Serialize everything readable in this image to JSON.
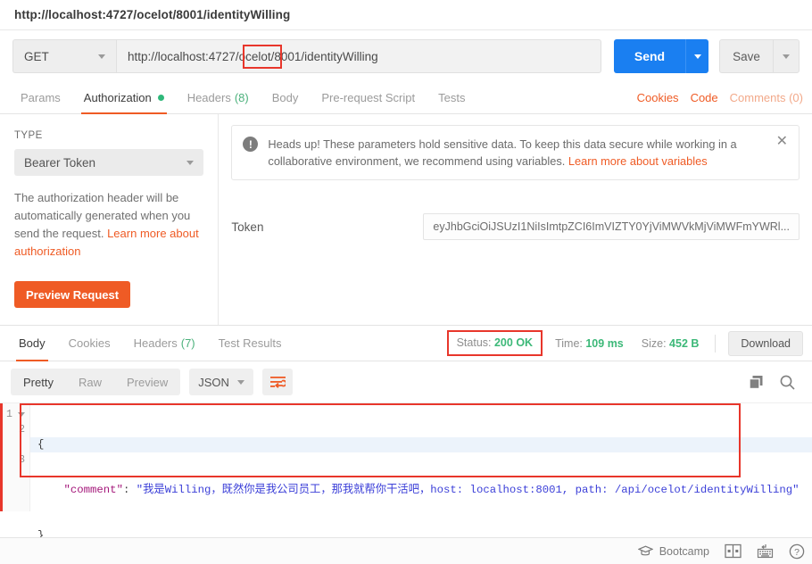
{
  "titlebar": {
    "url": "http://localhost:4727/ocelot/8001/identityWilling"
  },
  "request": {
    "method": "GET",
    "url": "http://localhost:4727/ocelot/8001/identityWilling",
    "url_highlight_fragment": "/8001",
    "send_label": "Send",
    "save_label": "Save",
    "tabs": [
      {
        "label": "Params",
        "count": "",
        "dot": false,
        "active": false
      },
      {
        "label": "Authorization",
        "count": "",
        "dot": true,
        "active": true
      },
      {
        "label": "Headers",
        "count": "(8)",
        "dot": false,
        "active": false
      },
      {
        "label": "Body",
        "count": "",
        "dot": false,
        "active": false
      },
      {
        "label": "Pre-request Script",
        "count": "",
        "dot": false,
        "active": false
      },
      {
        "label": "Tests",
        "count": "",
        "dot": false,
        "active": false
      }
    ],
    "right_links": [
      {
        "label": "Cookies",
        "muted": false
      },
      {
        "label": "Code",
        "muted": false
      },
      {
        "label": "Comments (0)",
        "muted": true
      }
    ]
  },
  "auth": {
    "type_label": "TYPE",
    "type_value": "Bearer Token",
    "description_text": "The authorization header will be automatically generated when you send the request. ",
    "description_link": "Learn more about authorization",
    "preview_button": "Preview Request",
    "notice_icon": "!",
    "notice_text": "Heads up! These parameters hold sensitive data. To keep this data secure while working in a collaborative environment, we recommend using variables. ",
    "notice_link": "Learn more about variables",
    "notice_close": "✕",
    "token_label": "Token",
    "token_value": "eyJhbGciOiJSUzI1NiIsImtpZCI6ImVIZTY0YjViMWVkMjViMWFmYWRl..."
  },
  "response": {
    "tabs": [
      {
        "label": "Body",
        "count": "",
        "active": true
      },
      {
        "label": "Cookies",
        "count": "",
        "active": false
      },
      {
        "label": "Headers",
        "count": "(7)",
        "active": false
      },
      {
        "label": "Test Results",
        "count": "",
        "active": false
      }
    ],
    "status_label": "Status:",
    "status_value": "200 OK",
    "time_label": "Time:",
    "time_value": "109 ms",
    "size_label": "Size:",
    "size_value": "452 B",
    "download_label": "Download",
    "format_tabs": [
      {
        "label": "Pretty",
        "active": true
      },
      {
        "label": "Raw",
        "active": false
      },
      {
        "label": "Preview",
        "active": false
      }
    ],
    "language": "JSON",
    "body": {
      "line1_number": "1",
      "line1_text": "{",
      "line2_number": "2",
      "line2_key": "\"comment\"",
      "line2_colon": ": ",
      "line2_value": "\"我是Willing，既然你是我公司员工，那我就帮你干活吧，host: localhost:8001, path: /api/ocelot/identityWilling\"",
      "line3_number": "3",
      "line3_text": "}"
    }
  },
  "statusbar": {
    "bootcamp_label": "Bootcamp"
  },
  "colors": {
    "accent_orange": "#ef5b25",
    "send_blue": "#1a7ff1",
    "status_green": "#3cb878",
    "annotation_red": "#e8362b",
    "json_string_blue": "#3b3fd8",
    "json_key_magenta": "#a4177a"
  }
}
